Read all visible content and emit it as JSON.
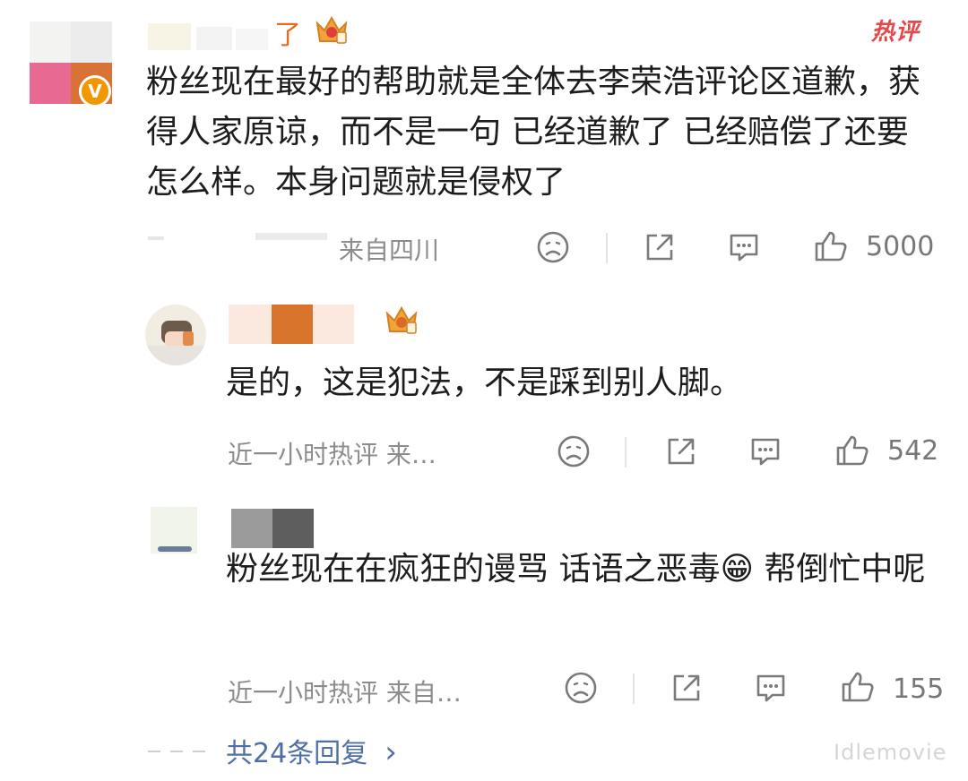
{
  "main_comment": {
    "username_tail": "了",
    "hot_label": "热评",
    "text": "粉丝现在最好的帮助就是全体去李荣浩评论区道歉，获得人家原谅，而不是一句 已经道歉了 已经赔偿了还要怎么样。本身问题就是侵权了",
    "meta": "来自四川",
    "likes": "5000",
    "verified_mark": "V"
  },
  "replies": [
    {
      "text": "是的，这是犯法，不是踩到别人脚。",
      "meta": "近一小时热评 来…",
      "likes": "542"
    },
    {
      "text": "粉丝现在在疯狂的谩骂 话语之恶毒😁 帮倒忙中呢",
      "meta": "近一小时热评 来自…",
      "likes": "155"
    }
  ],
  "more_replies": {
    "label": "共24条回复",
    "chevron": "›"
  },
  "watermark": "Idlemovie",
  "colors": {
    "hot_red": "#e8474a",
    "link_blue": "#4f6fa5",
    "meta_gray": "#8c8c8c",
    "crown_gold": "#f2a43a"
  }
}
